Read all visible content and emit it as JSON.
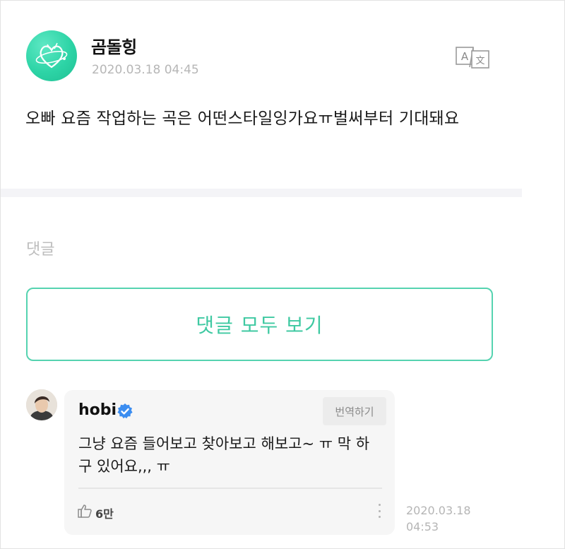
{
  "post": {
    "author": "곰돌힝",
    "date": "2020.03.18 04:45",
    "body": "오빠 요즘 작업하는 곡은 어떤스타일잉가요ㅠ벌써부터 기대돼요",
    "translate_icon": "translate-icon"
  },
  "comments": {
    "heading": "댓글",
    "view_all_label": "댓글 모두 보기",
    "items": [
      {
        "author": "hobi",
        "verified": true,
        "translate_label": "번역하기",
        "text": "그냥 요즘 들어보고 찾아보고 해보고~ ㅠ 막 하구 있어요,,, ㅠ",
        "likes": "6만",
        "date": "2020.03.18 04:53"
      }
    ]
  },
  "colors": {
    "accent": "#3fc9a2",
    "verified": "#3b8df0",
    "muted_text": "#b6b6b6"
  },
  "icons": [
    "translate-icon",
    "verified-badge-icon",
    "like-thumb-icon",
    "more-vertical-icon"
  ]
}
